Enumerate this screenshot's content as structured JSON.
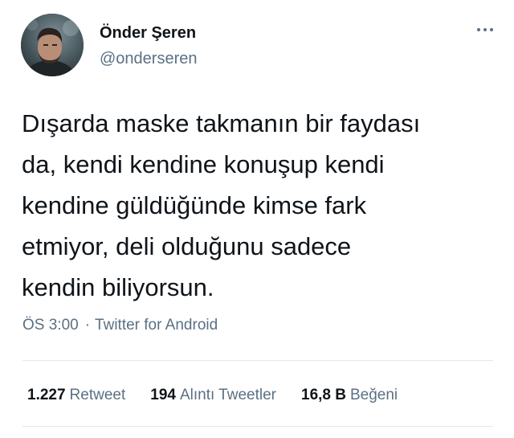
{
  "author": {
    "display_name": "Önder Şeren",
    "handle": "@onderseren",
    "avatar_icon": "profile-photo",
    "more_icon": "more-horizontal-icon"
  },
  "tweet": {
    "text": "Dışarda maske takmanın bir faydası\nda, kendi kendine konuşup kendi\nkendine güldüğünde kimse fark\netmiyor, deli olduğunu sadece\nkendin biliyorsun."
  },
  "meta": {
    "time": "ÖS 3:00",
    "separator": "·",
    "source": "Twitter for Android"
  },
  "stats": {
    "retweets": {
      "count": "1.227",
      "label": "Retweet"
    },
    "quotes": {
      "count": "194",
      "label": "Alıntı Tweetler"
    },
    "likes": {
      "count": "16,8 B",
      "label": "Beğeni"
    }
  },
  "colors": {
    "text_primary": "#0f1419",
    "text_secondary": "#5b7083",
    "divider": "#e1e8ed",
    "background": "#ffffff"
  }
}
